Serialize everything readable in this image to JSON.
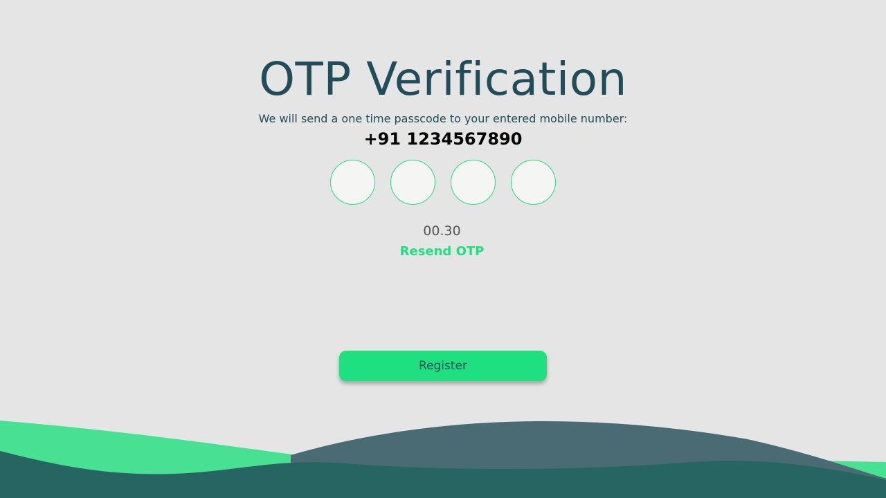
{
  "page": {
    "title": "OTP Verification",
    "subtitle": "We will send a one time passcode to your entered mobile number:",
    "phone_number": "+91 1234567890"
  },
  "otp": {
    "digit_count": 4,
    "values": [
      "",
      "",
      "",
      ""
    ]
  },
  "timer": {
    "text": "00.30"
  },
  "resend": {
    "label": "Resend OTP"
  },
  "register": {
    "label": "Register"
  },
  "colors": {
    "background": "#e5e5e5",
    "primary_dark": "#214c5a",
    "accent_green": "#1fe080",
    "wave_light_green": "#48e093",
    "wave_slate": "#4a6a74",
    "wave_teal": "#276562"
  }
}
